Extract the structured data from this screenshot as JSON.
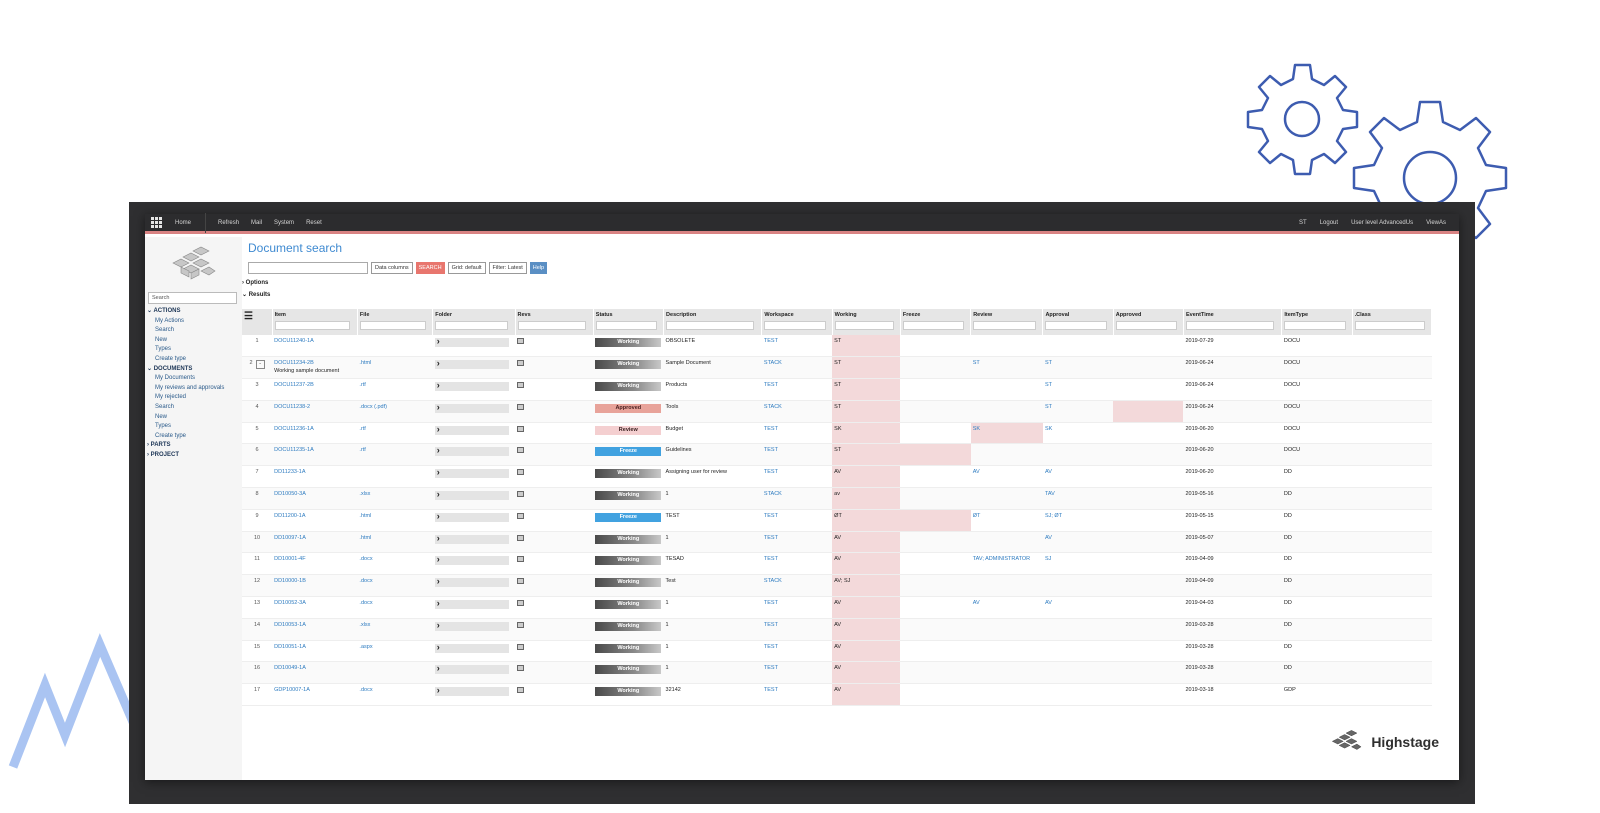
{
  "topbar": {
    "nav": [
      "Home",
      "Refresh",
      "Mail",
      "System",
      "Reset"
    ],
    "right": [
      "ST",
      "Logout",
      "User level AdvancedUs",
      "ViewAs"
    ]
  },
  "sidebar": {
    "search_placeholder": "Search",
    "groups": [
      {
        "label": "ACTIONS",
        "expanded": true,
        "items": [
          "My Actions",
          "Search",
          "New",
          "Types",
          "Create type"
        ]
      },
      {
        "label": "DOCUMENTS",
        "expanded": true,
        "items": [
          "My Documents",
          "My reviews and approvals",
          "My rejected",
          "Search",
          "New",
          "Types",
          "Create type"
        ]
      },
      {
        "label": "PARTS",
        "expanded": false,
        "items": []
      },
      {
        "label": "PROJECT",
        "expanded": false,
        "items": []
      }
    ]
  },
  "page": {
    "title": "Document search",
    "data_columns": "Data columns",
    "search_btn": "SEARCH",
    "grid_default": "Grid: default",
    "filter": "Filter: Latest",
    "help": "Help",
    "options_label": "Options",
    "results_label": "Results"
  },
  "table": {
    "headers": [
      "Item",
      "File",
      "Folder",
      "Revs",
      "Status",
      "Description",
      "Workspace",
      "Working",
      "Freeze",
      "Review",
      "Approval",
      "Approved",
      "EventTime",
      "ItemType",
      ".Class"
    ],
    "rows": [
      {
        "n": "1",
        "item": "DOCU11240-1A",
        "file": "",
        "status": "Working",
        "desc": "OBSOLETE",
        "ws": "TEST",
        "working": "ST",
        "freeze": "",
        "review": "",
        "approval": "",
        "time": "2019-07-29",
        "type": "DOCU",
        "extra": ""
      },
      {
        "n": "2",
        "item": "DOCU11234-2B",
        "file": ".html",
        "status": "Working",
        "desc": "Sample Document",
        "ws": "STACK",
        "working": "ST",
        "freeze": "",
        "review": "ST",
        "approval": "ST",
        "time": "2019-06-24",
        "type": "DOCU",
        "extra": "Working sample document"
      },
      {
        "n": "3",
        "item": "DOCU11237-2B",
        "file": ".rtf",
        "status": "Working",
        "desc": "Products",
        "ws": "TEST",
        "working": "ST",
        "freeze": "",
        "review": "",
        "approval": "ST",
        "time": "2019-06-24",
        "type": "DOCU",
        "extra": ""
      },
      {
        "n": "4",
        "item": "DOCU11238-2",
        "file": ".docx (.pdf)",
        "status": "Approved",
        "desc": "Tools",
        "ws": "STACK",
        "working": "ST",
        "freeze": "",
        "review": "",
        "approval": "ST",
        "time": "2019-06-24",
        "type": "DOCU",
        "extra": ""
      },
      {
        "n": "5",
        "item": "DOCU11236-1A",
        "file": ".rtf",
        "status": "Review",
        "desc": "Budget",
        "ws": "TEST",
        "working": "SK",
        "freeze": "",
        "review": "SK",
        "approval": "SK",
        "time": "2019-06-20",
        "type": "DOCU",
        "extra": ""
      },
      {
        "n": "6",
        "item": "DOCU11235-1A",
        "file": ".rtf",
        "status": "Freeze",
        "desc": "Guidelines",
        "ws": "TEST",
        "working": "ST",
        "freeze": "",
        "review": "",
        "approval": "",
        "time": "2019-06-20",
        "type": "DOCU",
        "extra": ""
      },
      {
        "n": "7",
        "item": "DD11233-1A",
        "file": "",
        "status": "Working",
        "desc": "Assigning user for review",
        "ws": "TEST",
        "working": "AV",
        "freeze": "",
        "review": "AV",
        "approval": "AV",
        "time": "2019-06-20",
        "type": "DD",
        "extra": ""
      },
      {
        "n": "8",
        "item": "DD10050-3A",
        "file": ".xlsx",
        "status": "Working",
        "desc": "1",
        "ws": "STACK",
        "working": "av",
        "freeze": "",
        "review": "",
        "approval": "TAV",
        "time": "2019-05-16",
        "type": "DD",
        "extra": ""
      },
      {
        "n": "9",
        "item": "DD11200-1A",
        "file": ".html",
        "status": "Freeze",
        "desc": "TEST",
        "ws": "TEST",
        "working": "ØT",
        "freeze": "",
        "review": "ØT",
        "approval": "SJ; ØT",
        "time": "2019-05-15",
        "type": "DD",
        "extra": ""
      },
      {
        "n": "10",
        "item": "DD10097-1A",
        "file": ".html",
        "status": "Working",
        "desc": "1",
        "ws": "TEST",
        "working": "AV",
        "freeze": "",
        "review": "",
        "approval": "AV",
        "time": "2019-05-07",
        "type": "DD",
        "extra": ""
      },
      {
        "n": "11",
        "item": "DD10001-4F",
        "file": ".docx",
        "status": "Working",
        "desc": "TESAD",
        "ws": "TEST",
        "working": "AV",
        "freeze": "",
        "review": "TAV; ADMINISTRATOR",
        "approval": "SJ",
        "time": "2019-04-09",
        "type": "DD",
        "extra": ""
      },
      {
        "n": "12",
        "item": "DD10000-1B",
        "file": ".docx",
        "status": "Working",
        "desc": "Test",
        "ws": "STACK",
        "working": "AV; SJ",
        "freeze": "",
        "review": "",
        "approval": "",
        "time": "2019-04-09",
        "type": "DD",
        "extra": ""
      },
      {
        "n": "13",
        "item": "DD10052-3A",
        "file": ".docx",
        "status": "Working",
        "desc": "1",
        "ws": "TEST",
        "working": "AV",
        "freeze": "",
        "review": "AV",
        "approval": "AV",
        "time": "2019-04-03",
        "type": "DD",
        "extra": ""
      },
      {
        "n": "14",
        "item": "DD10053-1A",
        "file": ".xlsx",
        "status": "Working",
        "desc": "1",
        "ws": "TEST",
        "working": "AV",
        "freeze": "",
        "review": "",
        "approval": "",
        "time": "2019-03-28",
        "type": "DD",
        "extra": ""
      },
      {
        "n": "15",
        "item": "DD10051-1A",
        "file": ".aspx",
        "status": "Working",
        "desc": "1",
        "ws": "TEST",
        "working": "AV",
        "freeze": "",
        "review": "",
        "approval": "",
        "time": "2019-03-28",
        "type": "DD",
        "extra": ""
      },
      {
        "n": "16",
        "item": "DD10049-1A",
        "file": "",
        "status": "Working",
        "desc": "1",
        "ws": "TEST",
        "working": "AV",
        "freeze": "",
        "review": "",
        "approval": "",
        "time": "2019-03-28",
        "type": "DD",
        "extra": ""
      },
      {
        "n": "17",
        "item": "GDP10007-1A",
        "file": ".docx",
        "status": "Working",
        "desc": "32142",
        "ws": "TEST",
        "working": "AV",
        "freeze": "",
        "review": "",
        "approval": "",
        "time": "2019-03-18",
        "type": "GDP",
        "extra": ""
      }
    ]
  },
  "brand": {
    "name": "Highstage"
  },
  "colors": {
    "accent": "#3f8ad1",
    "search": "#e8766e",
    "working_highlight": "#f3d9da",
    "freeze": "#41a2e0",
    "gear_stroke": "#3d5cb0",
    "arrow": "#aac4f2"
  }
}
